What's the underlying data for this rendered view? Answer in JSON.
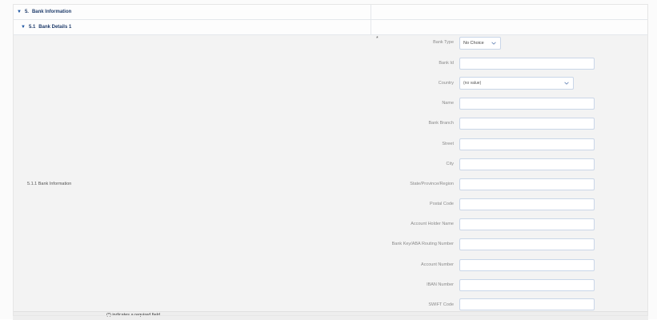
{
  "header": {
    "section_number": "5.",
    "section_title": "Bank Information",
    "subsection_number": "5.1",
    "subsection_title": "Bank Details 1"
  },
  "section_label": "5.1.1  Bank Information",
  "required_marker": "*",
  "fields": {
    "bank_type": {
      "label": "Bank Type",
      "value": "No Choice"
    },
    "bank_id": {
      "label": "Bank Id",
      "value": ""
    },
    "country": {
      "label": "Country",
      "value": "(no value)"
    },
    "name": {
      "label": "Name",
      "value": ""
    },
    "bank_branch": {
      "label": "Bank Branch",
      "value": ""
    },
    "street": {
      "label": "Street",
      "value": ""
    },
    "city": {
      "label": "City",
      "value": ""
    },
    "state": {
      "label": "State/Province/Region",
      "value": ""
    },
    "postal_code": {
      "label": "Postal Code",
      "value": ""
    },
    "account_holder": {
      "label": "Account Holder Name",
      "value": ""
    },
    "routing_number": {
      "label": "Bank Key/ABA Routing Number",
      "value": ""
    },
    "account_number": {
      "label": "Account Number",
      "value": ""
    },
    "iban": {
      "label": "IBAN Number",
      "value": ""
    },
    "swift": {
      "label": "SWIFT Code",
      "value": ""
    }
  },
  "footer_note": "(*) indicates a required field",
  "icons": {
    "expand": "caret-down-icon",
    "dropdown": "chevron-down-icon"
  }
}
